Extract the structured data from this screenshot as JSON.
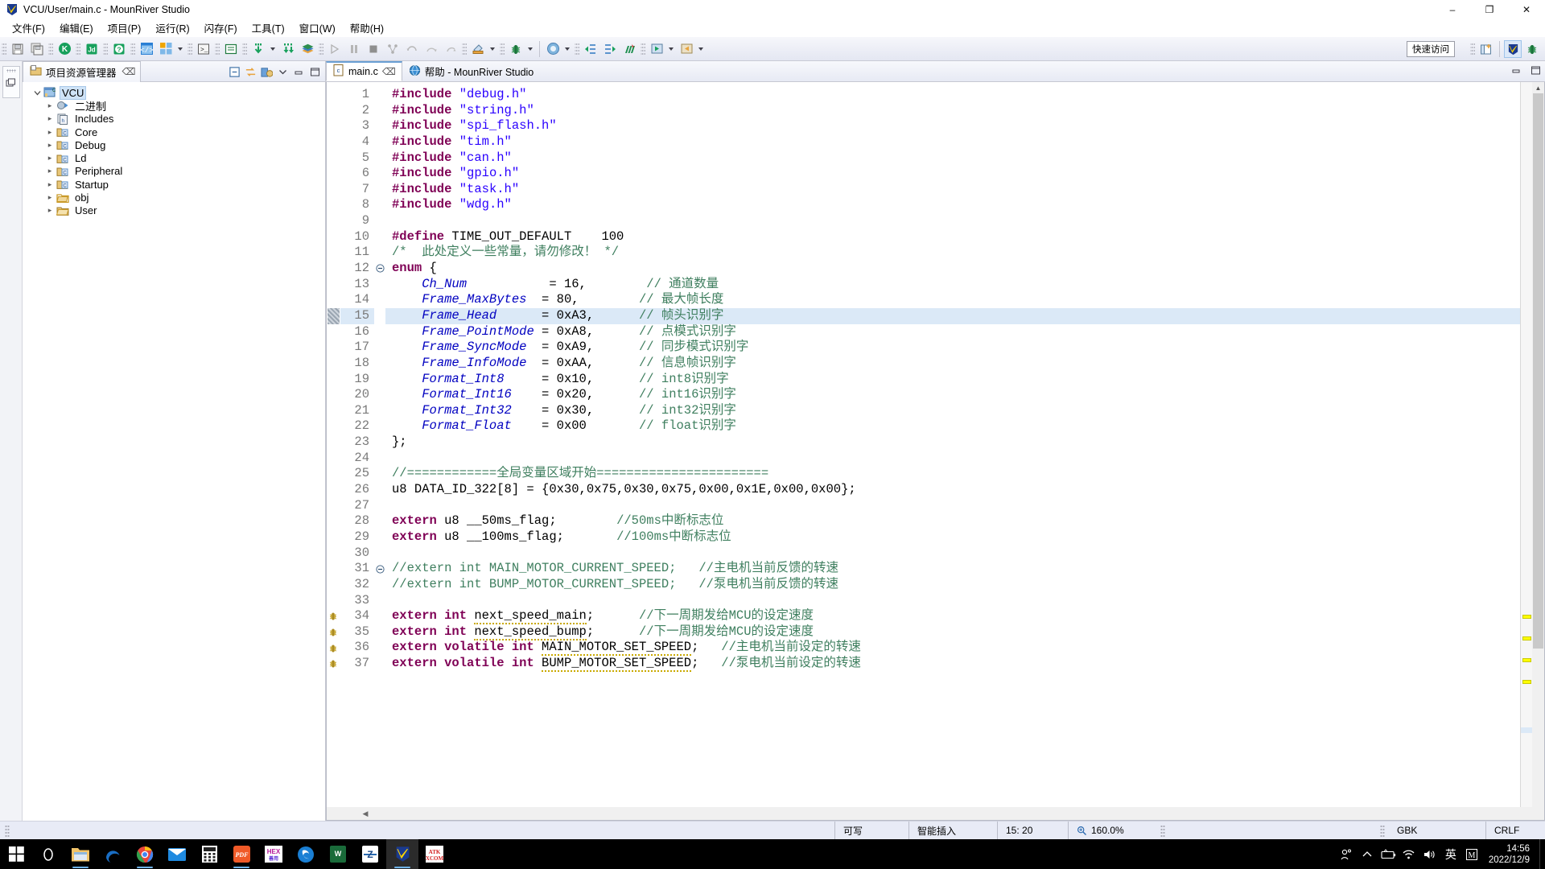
{
  "window": {
    "title": "VCU/User/main.c - MounRiver Studio",
    "app_icon": "mounriver-logo-icon",
    "minimize": "–",
    "maximize": "❐",
    "close": "✕"
  },
  "menubar": {
    "items": [
      {
        "label": "文件(F)",
        "name": "menu-file"
      },
      {
        "label": "编辑(E)",
        "name": "menu-edit"
      },
      {
        "label": "项目(P)",
        "name": "menu-project"
      },
      {
        "label": "运行(R)",
        "name": "menu-run"
      },
      {
        "label": "闪存(F)",
        "name": "menu-flash"
      },
      {
        "label": "工具(T)",
        "name": "menu-tools"
      },
      {
        "label": "窗口(W)",
        "name": "menu-window"
      },
      {
        "label": "帮助(H)",
        "name": "menu-help"
      }
    ]
  },
  "toolbar": {
    "quick_access": "快速访问",
    "buttons": [
      {
        "name": "save-button",
        "glyph": "save-icon"
      },
      {
        "name": "save-all-button",
        "glyph": "save-all-icon"
      },
      {
        "name": "build-k-button",
        "glyph": "build-k-icon"
      },
      {
        "name": "download-jd-button",
        "glyph": "download-jd-icon"
      },
      {
        "name": "help-question-button",
        "glyph": "question-icon"
      },
      {
        "name": "new-file-button",
        "glyph": "new-file-icon"
      },
      {
        "name": "new-project-button",
        "glyph": "new-project-icon"
      },
      {
        "name": "terminal-button",
        "glyph": "terminal-icon"
      },
      {
        "name": "console-button",
        "glyph": "console-icon"
      },
      {
        "name": "download-button",
        "glyph": "download-icon"
      },
      {
        "name": "download-all-button",
        "glyph": "download-all-icon"
      },
      {
        "name": "library-button",
        "glyph": "books-icon"
      },
      {
        "name": "resume-button",
        "glyph": "resume-icon"
      },
      {
        "name": "suspend-button",
        "glyph": "suspend-icon"
      },
      {
        "name": "terminate-button",
        "glyph": "stop-icon"
      },
      {
        "name": "disconnect-button",
        "glyph": "disconnect-icon"
      },
      {
        "name": "step-into-button",
        "glyph": "step-into-icon"
      },
      {
        "name": "step-over-button",
        "glyph": "step-over-icon"
      },
      {
        "name": "step-return-button",
        "glyph": "step-return-icon"
      },
      {
        "name": "build-button",
        "glyph": "hammer-icon"
      },
      {
        "name": "debug-button",
        "glyph": "bug-icon"
      },
      {
        "name": "run-button",
        "glyph": "run-icon"
      },
      {
        "name": "next-annotation-button",
        "glyph": "next-annotation-icon"
      },
      {
        "name": "previous-annotation-button",
        "glyph": "previous-annotation-icon"
      },
      {
        "name": "last-edit-button",
        "glyph": "last-edit-icon"
      },
      {
        "name": "back-button",
        "glyph": "back-icon"
      },
      {
        "name": "forward-button",
        "glyph": "forward-icon"
      }
    ],
    "right_buttons": [
      {
        "name": "new-perspective-button",
        "glyph": "perspective-icon"
      },
      {
        "name": "perspective-mounriver-button",
        "glyph": "mounriver-perspective-icon"
      },
      {
        "name": "perspective-debug-button",
        "glyph": "debug-perspective-icon"
      }
    ]
  },
  "explorer": {
    "tab_label": "项目资源管理器",
    "tab_icon": "project-explorer-icon",
    "close_icon": "close-icon",
    "tools": [
      {
        "name": "collapse-all-button",
        "glyph": "collapse-all-icon"
      },
      {
        "name": "link-with-editor-button",
        "glyph": "link-editor-icon"
      },
      {
        "name": "view-menu-build-button",
        "glyph": "build-config-icon"
      },
      {
        "name": "view-menu-button",
        "glyph": "chevron-down-icon"
      },
      {
        "name": "minimize-view-button",
        "glyph": "minimize-icon"
      },
      {
        "name": "maximize-view-button",
        "glyph": "maximize-icon"
      }
    ],
    "tree": [
      {
        "label": "VCU",
        "depth": 0,
        "expanded": true,
        "selected": true,
        "icon": "c-project-icon"
      },
      {
        "label": "二进制",
        "depth": 1,
        "expanded": false,
        "selected": false,
        "icon": "binaries-icon"
      },
      {
        "label": "Includes",
        "depth": 1,
        "expanded": false,
        "selected": false,
        "icon": "includes-icon"
      },
      {
        "label": "Core",
        "depth": 1,
        "expanded": false,
        "selected": false,
        "icon": "source-folder-icon"
      },
      {
        "label": "Debug",
        "depth": 1,
        "expanded": false,
        "selected": false,
        "icon": "source-folder-icon"
      },
      {
        "label": "Ld",
        "depth": 1,
        "expanded": false,
        "selected": false,
        "icon": "source-folder-icon"
      },
      {
        "label": "Peripheral",
        "depth": 1,
        "expanded": false,
        "selected": false,
        "icon": "source-folder-icon"
      },
      {
        "label": "Startup",
        "depth": 1,
        "expanded": false,
        "selected": false,
        "icon": "source-folder-icon"
      },
      {
        "label": "obj",
        "depth": 1,
        "expanded": false,
        "selected": false,
        "icon": "folder-icon"
      },
      {
        "label": "User",
        "depth": 1,
        "expanded": false,
        "selected": false,
        "icon": "folder-open-icon"
      }
    ]
  },
  "editor": {
    "tabs": [
      {
        "label": "main.c",
        "icon": "c-file-icon",
        "active": true,
        "closable": true
      },
      {
        "label": "帮助  -  MounRiver Studio",
        "icon": "help-globe-icon",
        "active": false,
        "closable": false
      }
    ],
    "view_tools": [
      {
        "name": "minimize-editor-button",
        "glyph": "minimize-icon"
      },
      {
        "name": "maximize-editor-button",
        "glyph": "maximize-icon"
      }
    ],
    "first_line": 1,
    "lines": [
      {
        "n": 1,
        "tokens": [
          {
            "t": "#include",
            "c": "pre"
          },
          {
            "t": " ",
            "c": "plain"
          },
          {
            "t": "\"debug.h\"",
            "c": "str"
          }
        ]
      },
      {
        "n": 2,
        "tokens": [
          {
            "t": "#include",
            "c": "pre"
          },
          {
            "t": " ",
            "c": "plain"
          },
          {
            "t": "\"string.h\"",
            "c": "str"
          }
        ]
      },
      {
        "n": 3,
        "tokens": [
          {
            "t": "#include",
            "c": "pre"
          },
          {
            "t": " ",
            "c": "plain"
          },
          {
            "t": "\"spi_flash.h\"",
            "c": "str"
          }
        ]
      },
      {
        "n": 4,
        "tokens": [
          {
            "t": "#include",
            "c": "pre"
          },
          {
            "t": " ",
            "c": "plain"
          },
          {
            "t": "\"tim.h\"",
            "c": "str"
          }
        ]
      },
      {
        "n": 5,
        "tokens": [
          {
            "t": "#include",
            "c": "pre"
          },
          {
            "t": " ",
            "c": "plain"
          },
          {
            "t": "\"can.h\"",
            "c": "str"
          }
        ]
      },
      {
        "n": 6,
        "tokens": [
          {
            "t": "#include",
            "c": "pre"
          },
          {
            "t": " ",
            "c": "plain"
          },
          {
            "t": "\"gpio.h\"",
            "c": "str"
          }
        ]
      },
      {
        "n": 7,
        "tokens": [
          {
            "t": "#include",
            "c": "pre"
          },
          {
            "t": " ",
            "c": "plain"
          },
          {
            "t": "\"task.h\"",
            "c": "str"
          }
        ]
      },
      {
        "n": 8,
        "tokens": [
          {
            "t": "#include",
            "c": "pre"
          },
          {
            "t": " ",
            "c": "plain"
          },
          {
            "t": "\"wdg.h\"",
            "c": "str"
          }
        ]
      },
      {
        "n": 9,
        "tokens": []
      },
      {
        "n": 10,
        "tokens": [
          {
            "t": "#define",
            "c": "pre"
          },
          {
            "t": " TIME_OUT_DEFAULT    100",
            "c": "plain"
          }
        ]
      },
      {
        "n": 11,
        "tokens": [
          {
            "t": "/*  此处定义一些常量，请勿修改！ */",
            "c": "cmt"
          }
        ]
      },
      {
        "n": 12,
        "fold": "collapse",
        "tokens": [
          {
            "t": "enum",
            "c": "pre"
          },
          {
            "t": " {",
            "c": "plain"
          }
        ]
      },
      {
        "n": 13,
        "tokens": [
          {
            "t": "    ",
            "c": "plain"
          },
          {
            "t": "Ch_Num",
            "c": "enum"
          },
          {
            "t": "           = 16,        ",
            "c": "plain"
          },
          {
            "t": "// 通道数量",
            "c": "cmt"
          }
        ]
      },
      {
        "n": 14,
        "tokens": [
          {
            "t": "    ",
            "c": "plain"
          },
          {
            "t": "Frame_MaxBytes",
            "c": "enum"
          },
          {
            "t": "  = 80,        ",
            "c": "plain"
          },
          {
            "t": "// 最大帧长度",
            "c": "cmt"
          }
        ]
      },
      {
        "n": 15,
        "hl": true,
        "tokens": [
          {
            "t": "    ",
            "c": "plain"
          },
          {
            "t": "Frame_Head",
            "c": "enum"
          },
          {
            "t": "      = 0xA3,      ",
            "c": "plain"
          },
          {
            "t": "// 帧头识别字",
            "c": "cmt"
          }
        ]
      },
      {
        "n": 16,
        "tokens": [
          {
            "t": "    ",
            "c": "plain"
          },
          {
            "t": "Frame_PointMode",
            "c": "enum"
          },
          {
            "t": " = 0xA8,      ",
            "c": "plain"
          },
          {
            "t": "// 点模式识别字",
            "c": "cmt"
          }
        ]
      },
      {
        "n": 17,
        "tokens": [
          {
            "t": "    ",
            "c": "plain"
          },
          {
            "t": "Frame_SyncMode",
            "c": "enum"
          },
          {
            "t": "  = 0xA9,      ",
            "c": "plain"
          },
          {
            "t": "// 同步模式识别字",
            "c": "cmt"
          }
        ]
      },
      {
        "n": 18,
        "tokens": [
          {
            "t": "    ",
            "c": "plain"
          },
          {
            "t": "Frame_InfoMode",
            "c": "enum"
          },
          {
            "t": "  = 0xAA,      ",
            "c": "plain"
          },
          {
            "t": "// 信息帧识别字",
            "c": "cmt"
          }
        ]
      },
      {
        "n": 19,
        "tokens": [
          {
            "t": "    ",
            "c": "plain"
          },
          {
            "t": "Format_Int8",
            "c": "enum"
          },
          {
            "t": "     = 0x10,      ",
            "c": "plain"
          },
          {
            "t": "// int8识别字",
            "c": "cmt"
          }
        ]
      },
      {
        "n": 20,
        "tokens": [
          {
            "t": "    ",
            "c": "plain"
          },
          {
            "t": "Format_Int16",
            "c": "enum"
          },
          {
            "t": "    = 0x20,      ",
            "c": "plain"
          },
          {
            "t": "// int16识别字",
            "c": "cmt"
          }
        ]
      },
      {
        "n": 21,
        "tokens": [
          {
            "t": "    ",
            "c": "plain"
          },
          {
            "t": "Format_Int32",
            "c": "enum"
          },
          {
            "t": "    = 0x30,      ",
            "c": "plain"
          },
          {
            "t": "// int32识别字",
            "c": "cmt"
          }
        ]
      },
      {
        "n": 22,
        "tokens": [
          {
            "t": "    ",
            "c": "plain"
          },
          {
            "t": "Format_Float",
            "c": "enum"
          },
          {
            "t": "    = 0x00       ",
            "c": "plain"
          },
          {
            "t": "// float识别字",
            "c": "cmt"
          }
        ]
      },
      {
        "n": 23,
        "tokens": [
          {
            "t": "};",
            "c": "plain"
          }
        ]
      },
      {
        "n": 24,
        "tokens": []
      },
      {
        "n": 25,
        "tokens": [
          {
            "t": "//============全局变量区域开始=======================",
            "c": "cmt"
          }
        ]
      },
      {
        "n": 26,
        "tokens": [
          {
            "t": "u8 DATA_ID_322[8] = {0x30,0x75,0x30,0x75,0x00,0x1E,0x00,0x00};",
            "c": "plain"
          }
        ]
      },
      {
        "n": 27,
        "tokens": []
      },
      {
        "n": 28,
        "tokens": [
          {
            "t": "extern",
            "c": "pre"
          },
          {
            "t": " u8 __50ms_flag;        ",
            "c": "plain"
          },
          {
            "t": "//50ms中断标志位",
            "c": "cmt"
          }
        ]
      },
      {
        "n": 29,
        "tokens": [
          {
            "t": "extern",
            "c": "pre"
          },
          {
            "t": " u8 __100ms_flag;       ",
            "c": "plain"
          },
          {
            "t": "//100ms中断标志位",
            "c": "cmt"
          }
        ]
      },
      {
        "n": 30,
        "tokens": []
      },
      {
        "n": 31,
        "fold": "collapse",
        "tokens": [
          {
            "t": "//extern int MAIN_MOTOR_CURRENT_SPEED;   //主电机当前反馈的转速",
            "c": "cmt"
          }
        ]
      },
      {
        "n": 32,
        "tokens": [
          {
            "t": "//extern int BUMP_MOTOR_CURRENT_SPEED;   //泵电机当前反馈的转速",
            "c": "cmt"
          }
        ]
      },
      {
        "n": 33,
        "tokens": []
      },
      {
        "n": 34,
        "warn": true,
        "tokens": [
          {
            "t": "extern int",
            "c": "pre"
          },
          {
            "t": " ",
            "c": "plain"
          },
          {
            "t": "next_speed_main",
            "c": "sq"
          },
          {
            "t": ";      ",
            "c": "plain"
          },
          {
            "t": "//下一周期发给MCU的设定速度",
            "c": "cmt"
          }
        ]
      },
      {
        "n": 35,
        "warn": true,
        "tokens": [
          {
            "t": "extern int",
            "c": "pre"
          },
          {
            "t": " ",
            "c": "plain"
          },
          {
            "t": "next_speed_bump",
            "c": "sq"
          },
          {
            "t": ";      ",
            "c": "plain"
          },
          {
            "t": "//下一周期发给MCU的设定速度",
            "c": "cmt"
          }
        ]
      },
      {
        "n": 36,
        "warn": true,
        "tokens": [
          {
            "t": "extern volatile int",
            "c": "pre"
          },
          {
            "t": " ",
            "c": "plain"
          },
          {
            "t": "MAIN_MOTOR_SET_SPEED",
            "c": "sq"
          },
          {
            "t": ";   ",
            "c": "plain"
          },
          {
            "t": "//主电机当前设定的转速",
            "c": "cmt"
          }
        ]
      },
      {
        "n": 37,
        "warn": true,
        "tokens": [
          {
            "t": "extern volatile int",
            "c": "pre"
          },
          {
            "t": " ",
            "c": "plain"
          },
          {
            "t": "BUMP_MOTOR_SET_SPEED",
            "c": "sq"
          },
          {
            "t": ";   ",
            "c": "plain"
          },
          {
            "t": "//泵电机当前设定的转速",
            "c": "cmt"
          }
        ]
      }
    ],
    "overview_markers": [
      {
        "top_pct": 73.5
      },
      {
        "top_pct": 76.5
      },
      {
        "top_pct": 79.5
      },
      {
        "top_pct": 82.5
      }
    ]
  },
  "statusbar": {
    "writable": "可写",
    "insert_mode": "智能插入",
    "cursor_position": "15: 20",
    "zoom": "160.0%",
    "zoom_icon": "zoom-icon",
    "encoding": "GBK",
    "line_delimiter": "CRLF"
  },
  "taskbar": {
    "items": [
      {
        "name": "start-button",
        "glyph": "windows-icon",
        "running": false,
        "active": false
      },
      {
        "name": "search-button",
        "glyph": "search-circle-icon",
        "running": false,
        "active": false
      },
      {
        "name": "file-explorer-button",
        "glyph": "folder-icon",
        "running": true,
        "active": false
      },
      {
        "name": "edge-button",
        "glyph": "edge-icon",
        "running": false,
        "active": false
      },
      {
        "name": "chrome-button",
        "glyph": "chrome-icon",
        "running": true,
        "active": false
      },
      {
        "name": "mail-button",
        "glyph": "mail-icon",
        "running": false,
        "active": false
      },
      {
        "name": "calculator-button",
        "glyph": "calculator-icon",
        "running": false,
        "active": false
      },
      {
        "name": "pdf-reader-button",
        "glyph": "pdf-icon",
        "running": true,
        "active": false
      },
      {
        "name": "hex-editor-button",
        "glyph": "hex-icon",
        "running": false,
        "active": false
      },
      {
        "name": "browser-button",
        "glyph": "blue-swirl-icon",
        "running": false,
        "active": false
      },
      {
        "name": "wps-button",
        "glyph": "wps-icon",
        "running": false,
        "active": false
      },
      {
        "name": "zotero-button",
        "glyph": "z-app-icon",
        "running": false,
        "active": false
      },
      {
        "name": "mounriver-button",
        "glyph": "mounriver-icon",
        "running": true,
        "active": true
      },
      {
        "name": "atk-xcom-button",
        "glyph": "atk-xcom-icon",
        "running": false,
        "active": false
      }
    ],
    "tray": [
      {
        "name": "people-icon",
        "glyph": "⛿"
      },
      {
        "name": "show-hidden-icons-icon",
        "glyph": "∧"
      },
      {
        "name": "battery-icon",
        "glyph": "▭"
      },
      {
        "name": "wifi-icon",
        "glyph": "◠"
      },
      {
        "name": "volume-icon",
        "glyph": "◁"
      },
      {
        "name": "ime-language-icon",
        "glyph": "英"
      },
      {
        "name": "ime-mode-icon",
        "glyph": "M"
      }
    ],
    "clock_time": "14:56",
    "clock_date": "2022/12/9"
  }
}
